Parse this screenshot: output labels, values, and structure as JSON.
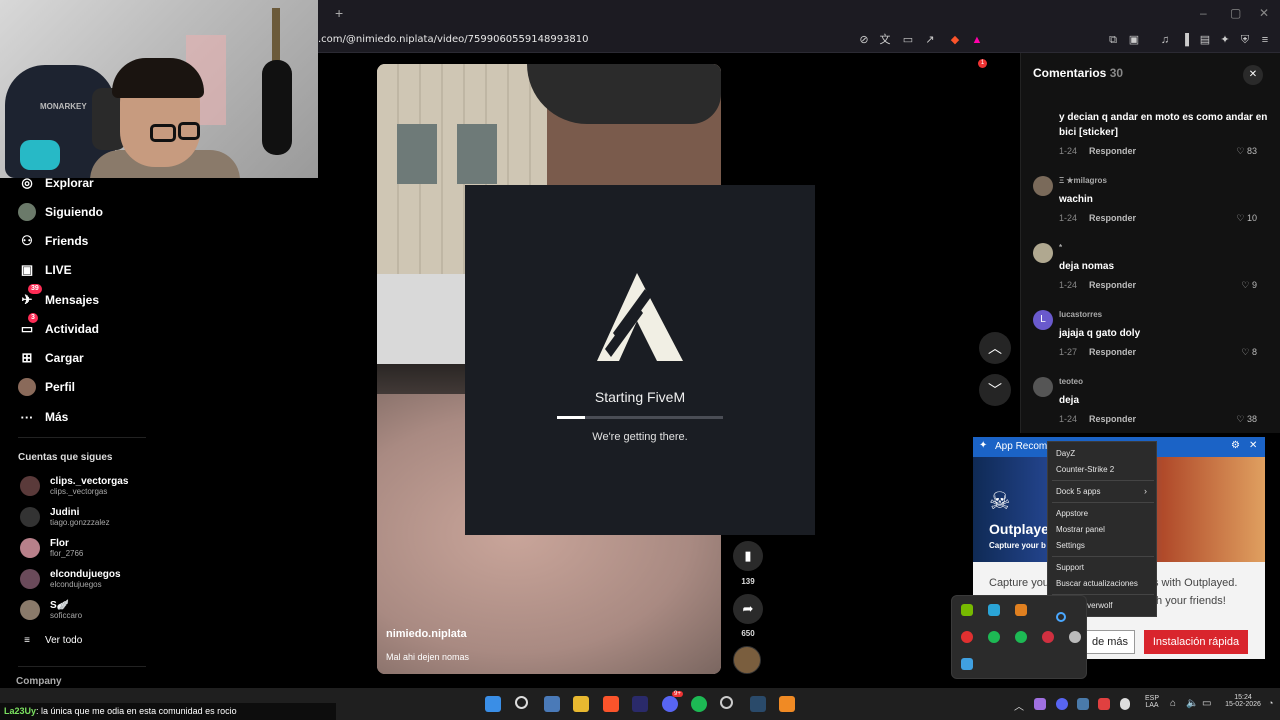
{
  "browser": {
    "url": ".com/@nimiedo.niplata/video/7599060559148993810",
    "new_tab": "+",
    "window_controls": [
      "–",
      "▢",
      "✕"
    ],
    "extension_badge": "1"
  },
  "webcam": {
    "chair_text": "MONARKEY"
  },
  "sidebar": {
    "nav": [
      {
        "label": "Explorar",
        "icon": "compass-icon",
        "glyph": "◎"
      },
      {
        "label": "Siguiendo",
        "icon": "following-avatar-icon",
        "glyph": ""
      },
      {
        "label": "Friends",
        "icon": "friends-icon",
        "glyph": "👥"
      },
      {
        "label": "LIVE",
        "icon": "live-icon",
        "glyph": "▣"
      },
      {
        "label": "Mensajes",
        "icon": "messages-icon",
        "glyph": "✈",
        "badge": "39"
      },
      {
        "label": "Actividad",
        "icon": "activity-icon",
        "glyph": "▭",
        "badge": "3"
      },
      {
        "label": "Cargar",
        "icon": "upload-icon",
        "glyph": "⊞"
      },
      {
        "label": "Perfil",
        "icon": "profile-avatar-icon",
        "glyph": ""
      },
      {
        "label": "Más",
        "icon": "more-icon",
        "glyph": "···"
      }
    ],
    "following_title": "Cuentas que sigues",
    "following": [
      {
        "name": "clips._vectorgas",
        "handle": "clips._vectorgas",
        "color": "#5a3a3a"
      },
      {
        "name": "Judini",
        "handle": "tiago.gonzzzalez",
        "color": "#333333"
      },
      {
        "name": "Flor",
        "handle": "flor_2766",
        "color": "#b8808a"
      },
      {
        "name": "elcondujuegos",
        "handle": "elcondujuegos",
        "color": "#6a4a5a"
      },
      {
        "name": "S🪽",
        "handle": "soficcaro",
        "color": "#8a7a6a"
      }
    ],
    "see_all": "Ver todo",
    "company": "Company"
  },
  "video": {
    "username": "nimiedo.niplata",
    "caption": "Mal ahi dejen nomas",
    "saves": "139",
    "shares": "650"
  },
  "fivem": {
    "title": "Starting FiveM",
    "subtitle": "We're getting there.",
    "progress": 0.17
  },
  "comments": {
    "title": "Comentarios",
    "count": "30",
    "items": [
      {
        "user": "",
        "text": "y decian q andar en moto es como andar en bici [sticker]",
        "date": "1-24",
        "likes": "83",
        "color": "#121212"
      },
      {
        "user": "Ξ ★milagros",
        "text": "wachin",
        "date": "1-24",
        "likes": "10",
        "color": "#7a6a5a"
      },
      {
        "user": "*",
        "text": "deja nomas",
        "date": "1-24",
        "likes": "9",
        "color": "#b0a890"
      },
      {
        "user": "lucastorres",
        "text": "jajaja q gato doly",
        "date": "1-27",
        "likes": "8",
        "color": "#6a5acd"
      },
      {
        "user": "teoteo",
        "text": "deja",
        "date": "1-24",
        "likes": "38",
        "color": "#555555"
      }
    ],
    "reply_label": "Responder",
    "avatar_letter": "L"
  },
  "outplayed": {
    "header": "App Recomm",
    "logo": "Outplaye",
    "tagline": "Capture your b",
    "desc_left": "Capture you",
    "desc_right1": "s with Outplayed.",
    "desc_right2": "th your friends!",
    "more_button": "de más",
    "install_button": "Instalación rápida"
  },
  "context_menu": {
    "items": [
      "DayZ",
      "Counter-Strike 2",
      "Dock 5 apps",
      "Appstore",
      "Mostrar panel",
      "Settings",
      "Support",
      "Buscar actualizaciones",
      "Cerrar Overwolf"
    ]
  },
  "chat": {
    "user": "La23Uy",
    "message": ": la única que me odia en esta comunidad es rocio"
  },
  "taskbar": {
    "lang_top": "ESP",
    "lang_bottom": "LAA",
    "time": "15:24",
    "date": "15-02-2026",
    "discord_badge": "9+"
  }
}
